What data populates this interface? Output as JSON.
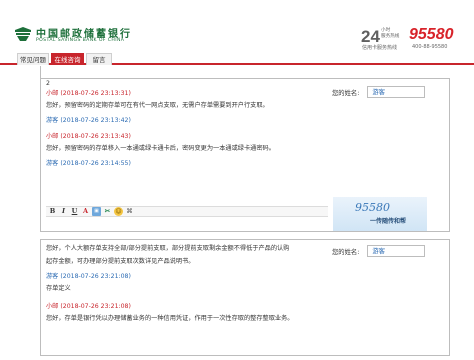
{
  "header": {
    "bank_name_cn": "中国邮政储蓄银行",
    "bank_name_en": "POSTAL SAVINGS BANK OF CHINA",
    "hotline_24": "24",
    "hotline_24_sub1": "小时",
    "hotline_24_sub2": "服务热线",
    "hotline_number": "95580",
    "card_hotline_label": "信用卡服务热线",
    "card_hotline_number": "400-88-95580"
  },
  "tabs": [
    {
      "label": "常见问题"
    },
    {
      "label": "在线咨询"
    },
    {
      "label": "留言"
    }
  ],
  "top_panel": {
    "first_line": "2",
    "messages": [
      {
        "head": "小邮 (2018-07-26 23:13:31)",
        "body": "您好，预留密码的定期存单可在有代一网点支取，无需户存单需要到开户行支取。"
      },
      {
        "head": "游客 (2018-07-26 23:13:42)",
        "body": ""
      },
      {
        "head": "小邮 (2018-07-26 23:13:43)",
        "body": "您好，预留密码的存单移入一本通或绿卡通卡后，密码变更为一本通或绿卡通密码。"
      },
      {
        "head": "游客 (2018-07-26 23:14:55)",
        "body": ""
      }
    ],
    "toolbar": [
      "B",
      "I",
      "U",
      "A"
    ],
    "name_label": "您的姓名:",
    "name_value": "游客",
    "promo_number": "95580",
    "promo_text": "一传随传和帮"
  },
  "bottom_panel": {
    "messages": [
      {
        "head": "",
        "body": "您好，个人大额存单支持全部/部分提前支取，部分提前支取剩余金额不得低于产品的认购"
      },
      {
        "head": "",
        "body": "起存金额，可办理部分提前支取次数详见产品说明书。"
      },
      {
        "head": "游客 (2018-07-26 23:21:08)",
        "body": "存单定义"
      },
      {
        "head": "小邮 (2018-07-26 23:21:08)",
        "body": "您好，存单是银行凭以办理储蓄业务的一种信用凭证，作用于一次性存取的整存整取业务。"
      }
    ],
    "name_label": "您的姓名:",
    "name_value": "游客"
  },
  "colors": {
    "brand_red": "#c8252c",
    "brand_green": "#1d6f3a",
    "user_blue": "#2c6bb3"
  }
}
